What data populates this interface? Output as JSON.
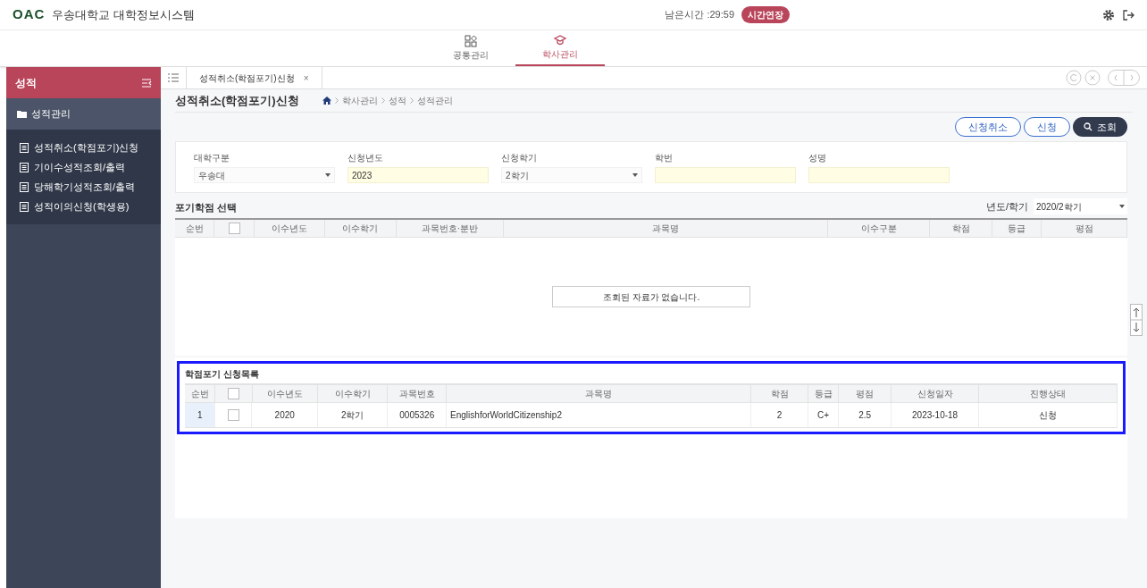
{
  "header": {
    "logo": "OAC",
    "title": "우송대학교 대학정보시스템",
    "timer": "남은시간 :29:59",
    "extend_button": "시간연장"
  },
  "nav": [
    {
      "label": "공통관리",
      "selected": false
    },
    {
      "label": "학사관리",
      "selected": true
    }
  ],
  "sidebar": {
    "title": "성적",
    "group": "성적관리",
    "items": [
      {
        "label": "성적취소(학점포기)신청"
      },
      {
        "label": "기이수성적조회/출력"
      },
      {
        "label": "당해학기성적조회/출력"
      },
      {
        "label": "성적이의신청(학생용)"
      }
    ]
  },
  "tabs": [
    {
      "label": "성적취소(학점포기)신청",
      "close": "×"
    }
  ],
  "page": {
    "title": "성적취소(학점포기)신청",
    "breadcrumb": [
      "학사관리",
      "성적",
      "성적관리"
    ],
    "buttons": [
      {
        "label": "신청취소",
        "kind": "outline"
      },
      {
        "label": "신청",
        "kind": "outline"
      },
      {
        "label": "조회",
        "kind": "search"
      }
    ]
  },
  "filters": [
    {
      "label": "대학구분",
      "kind": "select",
      "value": "우송대"
    },
    {
      "label": "신청년도",
      "kind": "input",
      "value": "2023"
    },
    {
      "label": "신청학기",
      "kind": "select",
      "value": "2학기"
    },
    {
      "label": "학번",
      "kind": "input"
    },
    {
      "label": "성명",
      "kind": "input"
    }
  ],
  "course_table": {
    "title": "포기학점 선택",
    "term_label": "년도/학기",
    "term_value": "2020/2학기",
    "header_checked": false,
    "columns": [
      "순번",
      "",
      "이수년도",
      "이수학기",
      "과목번호·분반",
      "과목명",
      "이수구분",
      "학점",
      "등급",
      "평점"
    ],
    "empty_message": "조회된 자료가 없습니다."
  },
  "request_table": {
    "title": "학점포기 신청목록",
    "header_checked": false,
    "columns": [
      "순번",
      "",
      "이수년도",
      "이수학기",
      "과목번호",
      "과목명",
      "학점",
      "등급",
      "평점",
      "신청일자",
      "진행상태"
    ],
    "rows": [
      {
        "selected": true,
        "checked": false,
        "cells": [
          "1",
          "",
          "2020",
          "2학기",
          "0005326",
          "EnglishforWorldCitizenship2",
          "2",
          "C+",
          "2.5",
          "2023-10-18",
          "신청"
        ]
      }
    ]
  }
}
